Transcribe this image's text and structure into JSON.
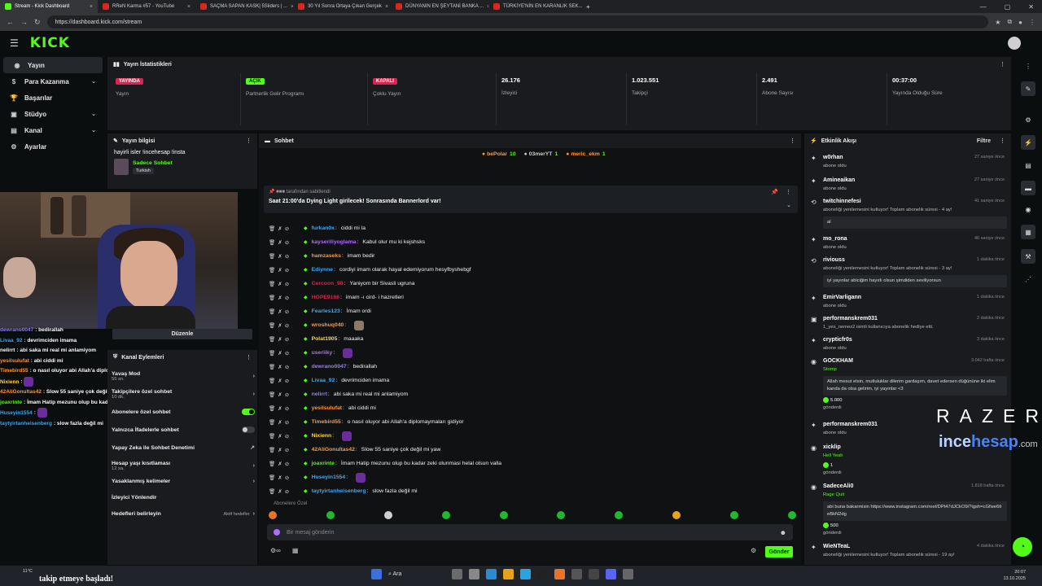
{
  "browser": {
    "tabs": [
      {
        "label": "Stream - Kick Dashboard",
        "active": true,
        "kind": "kick"
      },
      {
        "label": "RReN Karma #57 - YouTube",
        "active": false,
        "kind": "yt"
      },
      {
        "label": "SAÇMA SAPAN KASK| 5Sliders | ...",
        "active": false,
        "kind": "yt"
      },
      {
        "label": "30 Yıl Sonra Ortaya Çıkan Gerçek",
        "active": false,
        "kind": "yt"
      },
      {
        "label": "DÜNYANIN EN ŞEYTANİ BANKA ...",
        "active": false,
        "kind": "yt"
      },
      {
        "label": "TÜRKİYE'NİN EN KARANLIK SEK...",
        "active": false,
        "kind": "yt"
      }
    ],
    "url": "https://dashboard.kick.com/stream"
  },
  "logo": "KICK",
  "sidebar": {
    "items": [
      {
        "label": "Yayın",
        "icon": "broadcast-icon",
        "active": true,
        "chevron": false
      },
      {
        "label": "Para Kazanma",
        "icon": "money-icon",
        "active": false,
        "chevron": true
      },
      {
        "label": "Başarılar",
        "icon": "trophy-icon",
        "active": false,
        "chevron": false
      },
      {
        "label": "Stüdyo",
        "icon": "studio-icon",
        "active": false,
        "chevron": true
      },
      {
        "label": "Kanal",
        "icon": "channel-icon",
        "active": false,
        "chevron": true
      },
      {
        "label": "Ayarlar",
        "icon": "gear-icon",
        "active": false,
        "chevron": false
      }
    ]
  },
  "stats": {
    "title": "Yayın İstatistikleri",
    "items": [
      {
        "badge": "YAYINDA",
        "badge_color": "#d7264f",
        "label": "Yayın"
      },
      {
        "badge": "AÇIK",
        "badge_color": "#53fc18",
        "label": "Partnerlik Gelir Programı"
      },
      {
        "badge": "KAPALI",
        "badge_color": "#d7264f",
        "label": "Çoklu Yayın"
      },
      {
        "value": "26.176",
        "label": "İzleyici"
      },
      {
        "value": "1.023.551",
        "label": "Takipçi"
      },
      {
        "value": "2.491",
        "label": "Abone Sayısı"
      },
      {
        "value": "00:37:00",
        "label": "Yayında Olduğu Süre"
      }
    ]
  },
  "stream_info": {
    "title": "Yayın bilgisi",
    "stream_title": "hayirli isler !incehesap !insta",
    "mode": "Sadece Sohbet",
    "language": "Turkish",
    "edit_label": "Düzenle"
  },
  "overlay_chat": [
    {
      "user": "dewrano0047",
      "color": "#9b7bff",
      "text": "bedirallah"
    },
    {
      "user": "Livaa_92",
      "color": "#3fa9f5",
      "text": "devrimciden imama"
    },
    {
      "user": "nelirrt",
      "color": "#ffffff",
      "text": "abi saka mi real mi anlamiyom"
    },
    {
      "user": "yesilsulufat",
      "color": "#ff9a3c",
      "text": "abi ciddi mi"
    },
    {
      "user": "Timebird55",
      "color": "#ff9a3c",
      "text": "o nasıl oluyor abi Allah'a diplomaymaları gidiyor"
    },
    {
      "user": "Nixienn",
      "color": "#ffd84a",
      "text": ""
    },
    {
      "user": "42AliGonultas42",
      "color": "#ff9a3c",
      "text": "Slow 55 saniye çok değil mi yaw"
    },
    {
      "user": "joaxrinte",
      "color": "#53fc18",
      "text": "İmam Hatip mezunu olup bu kadar zeki olunmasi helal olsun valla"
    },
    {
      "user": "Huseyin1554",
      "color": "#3fa9f5",
      "text": ""
    },
    {
      "user": "taytyirtanheisenberg",
      "color": "#3fa9f5",
      "text": "slow fazla değil mi"
    }
  ],
  "channel_actions": {
    "title": "Kanal Eylemleri",
    "items": [
      {
        "label": "Yavaş Mod",
        "sub": "55 sn.",
        "control": "chevron"
      },
      {
        "label": "Takipçilere özel sohbet",
        "sub": "10 dk.",
        "control": "chevron"
      },
      {
        "label": "Abonelere özel sohbet",
        "control": "toggle-on"
      },
      {
        "label": "Yalnızca İfadelerle sohbet",
        "control": "toggle-off"
      },
      {
        "label": "Yapay Zeka ile Sohbet Denetimi",
        "control": "external"
      },
      {
        "label": "Hesap yaşı kısıtlaması",
        "sub": "12 sa.",
        "control": "chevron"
      },
      {
        "label": "Yasaklanmış kelimeler",
        "control": "chevron"
      },
      {
        "label": "İzleyici Yönlendir",
        "control": "none"
      },
      {
        "label": "Hedefleri belirleyin",
        "right_text": "Aktif hedefler",
        "control": "chevron"
      }
    ]
  },
  "chat": {
    "title": "Sohbet",
    "top_supporters": [
      {
        "name": "bePolar",
        "amount": "10",
        "color": "#ff9a3c"
      },
      {
        "name": "03merYT",
        "amount": "1",
        "color": "#cccccc"
      },
      {
        "name": "meric_ekm",
        "amount": "1",
        "color": "#ff9a3c"
      }
    ],
    "pinned_by": "tarafından sabitlendi",
    "pinned_text": "Saat 21:00'da Dying Light girilecek! Sonrasında Bannerlord var!",
    "messages": [
      {
        "user": "furkan0x",
        "color": "#3fa9f5",
        "text": "ciddi mi la",
        "emote": ""
      },
      {
        "user": "kayseriliyoglama",
        "color": "#b06cff",
        "text": "Kabul olur mu ki kejshsks",
        "emote": ""
      },
      {
        "user": "hamzaseks",
        "color": "#ff9a3c",
        "text": "imam bedir",
        "emote": ""
      },
      {
        "user": "Ediynne",
        "color": "#3fa9f5",
        "text": "cordiyi imam olarak hayal edemiyorum hesyfbyshebgf",
        "emote": ""
      },
      {
        "user": "Cercoon_98",
        "color": "#d7264f",
        "text": "Yaniyom bir Sivasli ugruna",
        "emote": ""
      },
      {
        "user": "HOPE9166",
        "color": "#d7264f",
        "text": "imam -ı cird- i hazretleri",
        "emote": ""
      },
      {
        "user": "Fearles123",
        "color": "#3fa9f5",
        "text": "İmam ordi",
        "emote": ""
      },
      {
        "user": "wroshuq040",
        "color": "#ff9a3c",
        "text": "",
        "emote": "pic"
      },
      {
        "user": "Polat1905",
        "color": "#ffd84a",
        "text": "maaaka",
        "emote": ""
      },
      {
        "user": "useriiky",
        "color": "#b06cff",
        "text": "",
        "emote": "purple"
      },
      {
        "user": "dewrano0047",
        "color": "#9b7bff",
        "text": "bedirallah",
        "emote": ""
      },
      {
        "user": "Livaa_92",
        "color": "#3fa9f5",
        "text": "devrimciden imama",
        "emote": ""
      },
      {
        "user": "nelirrt",
        "color": "#9b7bff",
        "text": "abi saka mi real mi anlamiyom",
        "emote": ""
      },
      {
        "user": "yesilsulufat",
        "color": "#ff9a3c",
        "text": "abi ciddi mi",
        "emote": ""
      },
      {
        "user": "Timebird55",
        "color": "#ff9a3c",
        "text": "o nasıl oluyor abi Allah'a diplomaymaları gidiyor",
        "emote": ""
      },
      {
        "user": "Nixienn",
        "color": "#ffd84a",
        "text": "",
        "emote": "purple"
      },
      {
        "user": "42AliGonultas42",
        "color": "#ff9a3c",
        "text": "Slow 55 saniye çok değil mi yaw",
        "emote": ""
      },
      {
        "user": "joaxrinte",
        "color": "#53fc18",
        "text": "İmam Hatip mezunu olup bu kadar zeki olunmasi helal olsun valla",
        "emote": ""
      },
      {
        "user": "Huseyin1554",
        "color": "#3fa9f5",
        "text": "",
        "emote": "purple"
      },
      {
        "user": "taytyirtanheisenberg",
        "color": "#3fa9f5",
        "text": "slow fazla değil mi",
        "emote": ""
      }
    ],
    "subs_only_label": "Abonelere Özel",
    "input_placeholder": "Bir mesaj gönderin",
    "send_label": "Gönder"
  },
  "activity": {
    "title": "Etkinlik Akışı",
    "filter_label": "Filtre",
    "events": [
      {
        "icon": "star-icon",
        "name": "w0rhan",
        "time": "27 saniye önce",
        "desc": "abone oldu"
      },
      {
        "icon": "star-icon",
        "name": "Amineaikan",
        "time": "27 saniye önce",
        "desc": "abone oldu"
      },
      {
        "icon": "resub-icon",
        "name": "twitchinnefesi",
        "time": "41 saniye önce",
        "desc": "aboneliği yenilemesini kutluyor! Toplam abonelik süresi - 4 ay!",
        "box": "al"
      },
      {
        "icon": "star-icon",
        "name": "mo_rona",
        "time": "46 saniye önce",
        "desc": "abone oldu"
      },
      {
        "icon": "resub-icon",
        "name": "riviouss",
        "time": "1 dakika önce",
        "desc": "aboneliği yenilemesini kutluyor! Toplam abonelik süresi - 3 ay!",
        "box": "iyi yayınlar abiciğim hayırlı olsun şimdiden seviliyorsun"
      },
      {
        "icon": "star-icon",
        "name": "EmirVarligann",
        "time": "1 dakika önce",
        "desc": "abone oldu"
      },
      {
        "icon": "gift-icon",
        "name": "performanskrem031",
        "time": "2 dakika önce",
        "desc": "1_yes_nemez2 isimli kullanıcıya abonelik hediye etti."
      },
      {
        "icon": "star-icon",
        "name": "crypticfr0s",
        "time": "3 dakika önce",
        "desc": "abone oldu"
      },
      {
        "icon": "kicks-icon",
        "name": "GOCKHAM",
        "time": "3.042 hafta önce",
        "desc": "Stomp",
        "box": "Allah mesut etsin, mutluluklar dilerim gardaşım, davet edersen düğününe iki elim kanda da olsa gelirim, iyi yayınlar <3",
        "kicks": "5.000",
        "tail": "gönderdi"
      },
      {
        "icon": "star-icon",
        "name": "performanskrem031",
        "time": "",
        "desc": "abone oldu"
      },
      {
        "icon": "kicks-icon",
        "name": "xicklip",
        "time": "",
        "desc": "Hell Yeah",
        "kicks": "1",
        "tail": "gönderdi"
      },
      {
        "icon": "kicks-icon",
        "name": "SadeceAli0",
        "time": "1.818 hafta önce",
        "desc": "Rage Quit",
        "box": "abi buna bakarmisin https://www.instagram.com/reel/DPt47dJCkO9/?igsh=cGfwe6tleBkN2dg",
        "kicks": "500",
        "tail": "gönderdi"
      },
      {
        "icon": "star-icon",
        "name": "WieNTeaL",
        "time": "4 dakika önce",
        "desc": "aboneliği yenilemesini kutluyor! Toplam abonelik süresi - 19 ay!"
      }
    ]
  },
  "brand_overlay": {
    "razer": "RAZER",
    "ince_a": "ince",
    "ince_b": "hesap",
    "ince_c": ".com"
  },
  "follow_overlay": "takip etmeye başladı!",
  "taskbar": {
    "weather": "11°C",
    "search": "Ara",
    "time": "20:07",
    "date": "13.10.2025"
  }
}
